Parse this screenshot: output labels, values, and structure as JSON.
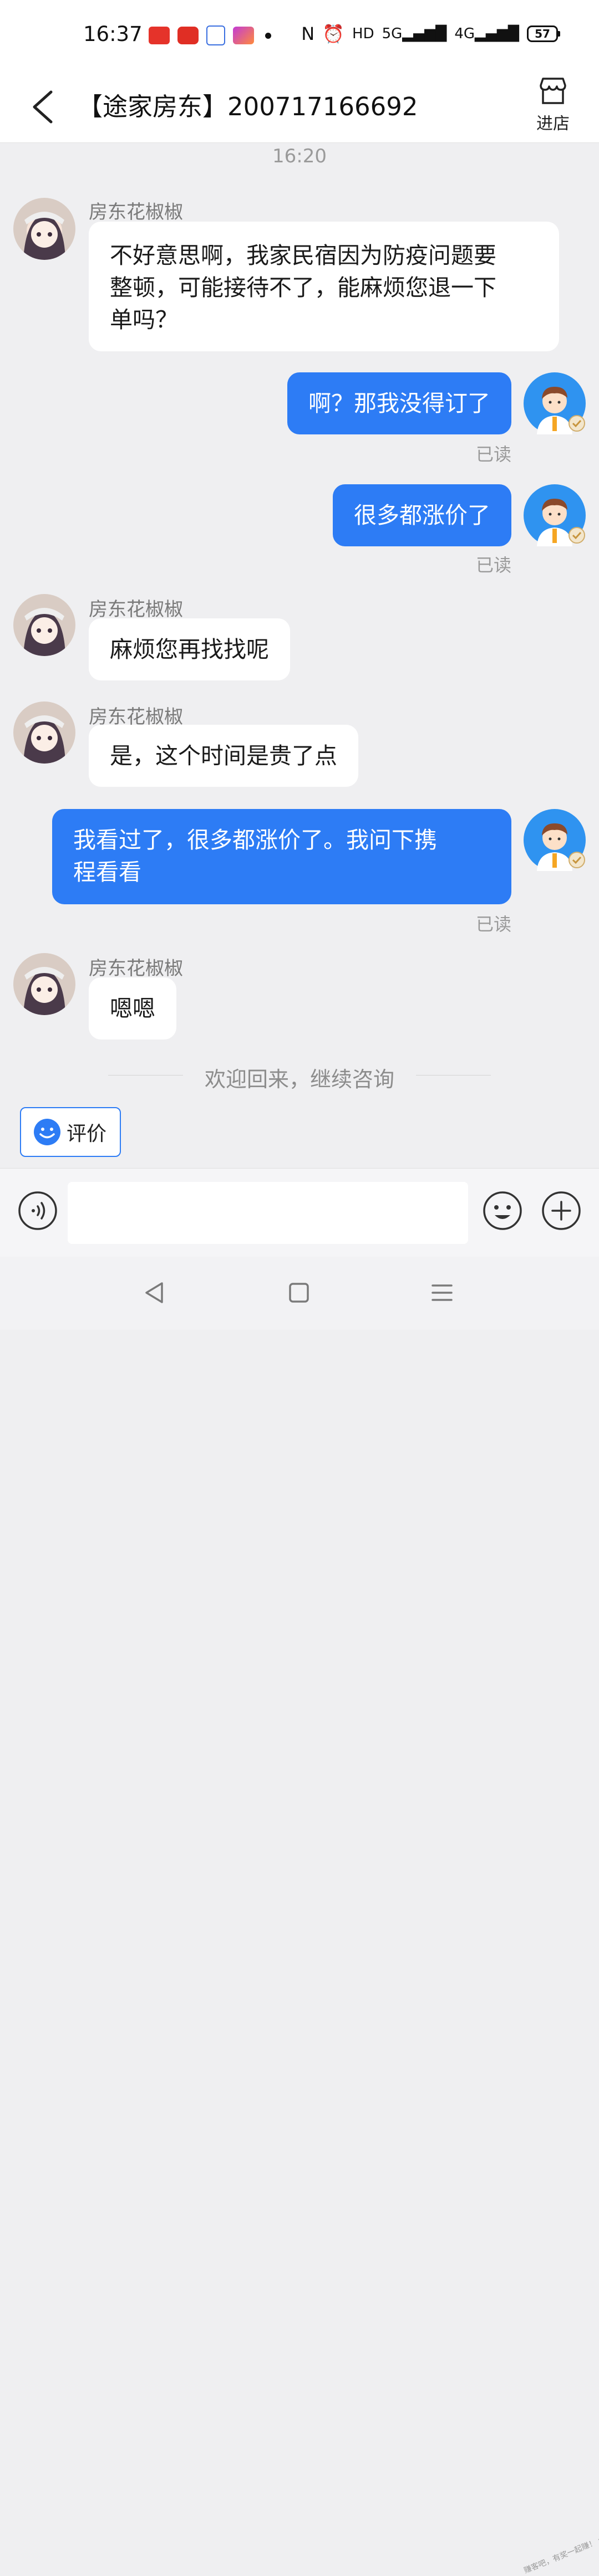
{
  "status_bar": {
    "time": "16:37",
    "network_hd": "HD",
    "network_5g": "5G",
    "network_4g": "4G",
    "battery": "57"
  },
  "header": {
    "title": "【途家房东】200717166692",
    "store_label": "进店"
  },
  "timestamp": "16:20",
  "messages": [
    {
      "side": "left",
      "sender": "房东花椒椒",
      "lines": [
        "不好意思啊，我家民宿因为防疫问题要",
        "整顿，可能接待不了，能麻烦您退一下",
        "单吗？"
      ]
    },
    {
      "side": "right",
      "text": "啊？那我没得订了",
      "read": "已读"
    },
    {
      "side": "right",
      "text": "很多都涨价了",
      "read": "已读"
    },
    {
      "side": "left",
      "sender": "房东花椒椒",
      "text": "麻烦您再找找呢"
    },
    {
      "side": "left",
      "sender": "房东花椒椒",
      "text": "是，这个时间是贵了点"
    },
    {
      "side": "right",
      "lines": [
        "我看过了，很多都涨价了。我问下携",
        "程看看"
      ],
      "read": "已读"
    },
    {
      "side": "left",
      "sender": "房东花椒椒",
      "text": "嗯嗯"
    }
  ],
  "divider_text": "欢迎回来，继续咨询",
  "rate_button": {
    "label": "评价"
  },
  "input": {
    "placeholder": ""
  },
  "watermark": "赚客吧，有奖一起赚！ www.zuanke8.com",
  "colors": {
    "accent": "#2d7cf5",
    "background": "#efeff1"
  }
}
